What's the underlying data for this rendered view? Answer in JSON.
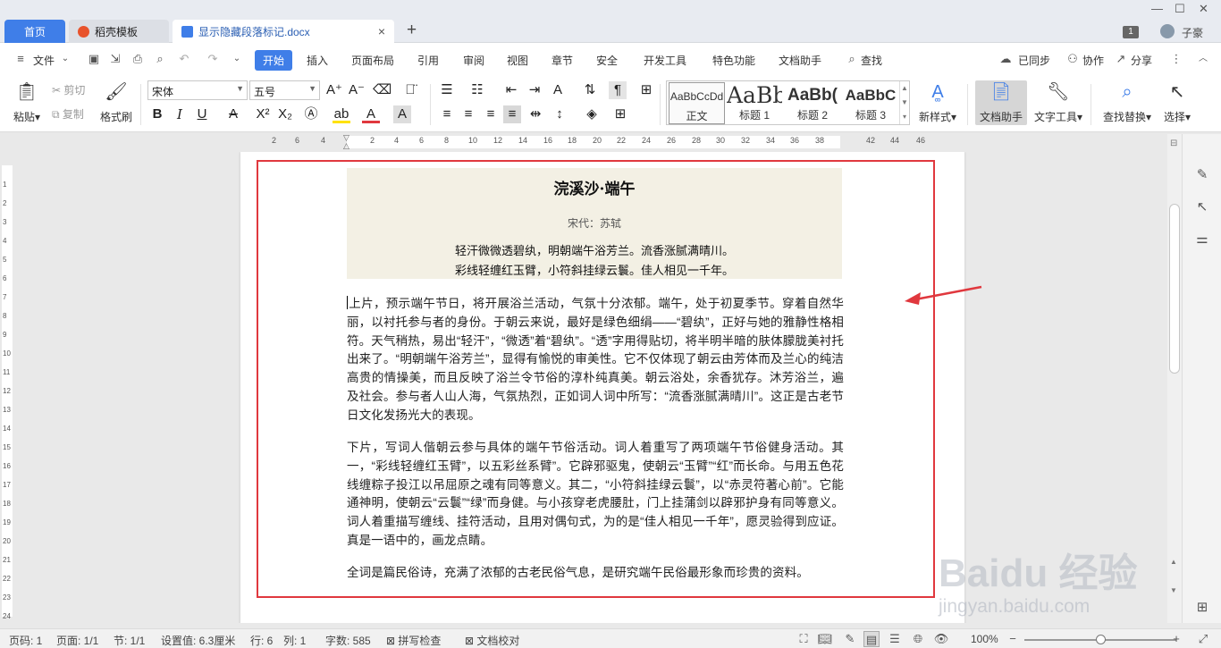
{
  "tabs": {
    "home": "首页",
    "daoke": "稻壳模板",
    "doc": "显示隐藏段落标记.docx",
    "close": "×",
    "add": "+"
  },
  "titlebar": {
    "page_count": "1",
    "user": "子豪"
  },
  "menu": {
    "file": "文件",
    "items": [
      "开始",
      "插入",
      "页面布局",
      "引用",
      "审阅",
      "视图",
      "章节",
      "安全",
      "开发工具",
      "特色功能",
      "文档助手"
    ],
    "search": "查找",
    "sync": "已同步",
    "collab": "协作",
    "share": "分享"
  },
  "ribbon": {
    "paste": "粘贴",
    "cut": "剪切",
    "copy": "复制",
    "format_painter": "格式刷",
    "font_name": "宋体",
    "font_size": "五号",
    "styles": [
      {
        "preview": "AaBbCcDd",
        "name": "正文"
      },
      {
        "preview": "AaBb",
        "name": "标题 1"
      },
      {
        "preview": "AaBb(",
        "name": "标题 2"
      },
      {
        "preview": "AaBbC",
        "name": "标题 3"
      }
    ],
    "new_style": "新样式",
    "doc_assistant": "文档助手",
    "text_tools": "文字工具",
    "find_replace": "查找替换",
    "select": "选择"
  },
  "ruler_ticks": [
    "6",
    "4",
    "2",
    "2",
    "4",
    "6",
    "8",
    "10",
    "12",
    "14",
    "16",
    "18",
    "20",
    "22",
    "24",
    "26",
    "28",
    "30",
    "32",
    "34",
    "36",
    "38",
    "42",
    "44",
    "46"
  ],
  "vruler_ticks": [
    "1",
    "2",
    "3",
    "4",
    "5",
    "6",
    "7",
    "8",
    "9",
    "10",
    "11",
    "12",
    "13",
    "14",
    "15",
    "16",
    "17",
    "18",
    "19",
    "20",
    "21",
    "22",
    "23",
    "24"
  ],
  "document": {
    "title": "浣溪沙·端午",
    "author": "宋代：苏轼",
    "lines": [
      "轻汗微微透碧纨，明朝端午浴芳兰。流香涨腻满晴川。",
      "彩线轻缠红玉臂，小符斜挂绿云鬟。佳人相见一千年。"
    ],
    "para1": "上片，预示端午节日，将开展浴兰活动，气氛十分浓郁。端午，处于初夏季节。穿着自然华丽，以衬托参与者的身份。于朝云来说，最好是绿色细绢——“碧纨”，正好与她的雅静性格相符。天气稍热，易出“轻汗”，“微透”着“碧纨”。“透”字用得贴切，将半明半暗的肤体朦胧美衬托出来了。“明朝端午浴芳兰”，显得有愉悦的审美性。它不仅体现了朝云由芳体而及兰心的纯洁高贵的情操美，而且反映了浴兰令节俗的淳朴纯真美。朝云浴处，余香犹存。沐芳浴兰，遍及社会。参与者人山人海，气氛热烈，正如词人词中所写：“流香涨腻满晴川”。这正是古老节日文化发扬光大的表现。",
    "para2": "下片，写词人偕朝云参与具体的端午节俗活动。词人着重写了两项端午节俗健身活动。其一，“彩线轻缠红玉臂”，以五彩丝系臂”。它辟邪驱鬼，使朝云“玉臂”“红”而长命。与用五色花线缠粽子投江以吊屈原之魂有同等意义。其二，“小符斜挂绿云鬟”，以“赤灵符著心前”。它能通神明，使朝云“云鬟”“绿”而身健。与小孩穿老虎腰肚，门上挂蒲剑以辟邪护身有同等意义。词人着重描写缠线、挂符活动，且用对偶句式，为的是“佳人相见一千年”，愿灵验得到应证。真是一语中的，画龙点睛。",
    "para3": "全词是篇民俗诗，充满了浓郁的古老民俗气息，是研究端午民俗最形象而珍贵的资料。"
  },
  "watermark": {
    "brand": "Baidu 经验",
    "url": "jingyan.baidu.com"
  },
  "status": {
    "page": "页码: 1",
    "pages": "页面: 1/1",
    "section": "节: 1/1",
    "setting": "设置值: 6.3厘米",
    "row": "行: 6",
    "col": "列: 1",
    "words": "字数: 585",
    "spell": "拼写检查",
    "proof": "文档校对",
    "zoom": "100%",
    "zoom_level": 0.5
  },
  "colors": {
    "accent": "#3f7ee8",
    "highlight_box": "#e0383e",
    "poem_bg": "#f3f0e4"
  }
}
